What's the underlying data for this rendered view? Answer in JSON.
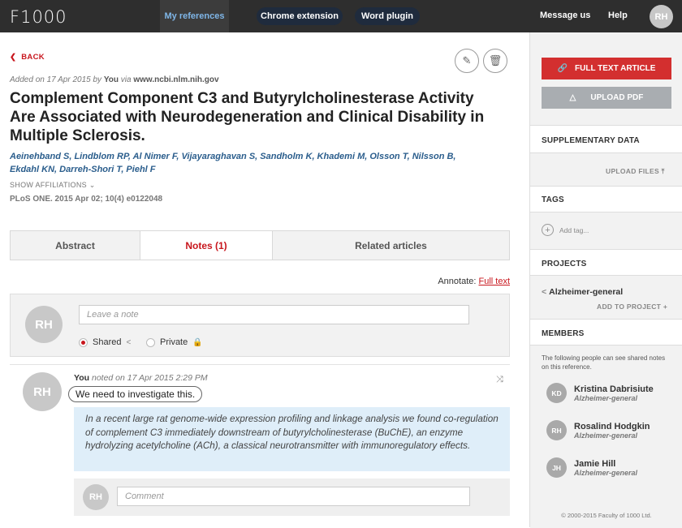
{
  "header": {
    "logo": "F1000",
    "nav_active": "My references",
    "chrome_extension": "Chrome extension",
    "word_plugin": "Word plugin",
    "message_us": "Message us",
    "help": "Help",
    "user_initials": "RH"
  },
  "article": {
    "back_label": "BACK",
    "added_prefix": "Added on 17 Apr 2015 by",
    "added_user": "You",
    "added_via": "via",
    "added_source": "www.ncbi.nlm.nih.gov",
    "title": "Complement Component C3 and Butyrylcholinesterase Activity Are Associated with Neurodegeneration and Clinical Disability in Multiple Sclerosis.",
    "authors": "Aeinehband S, Lindblom RP, Al Nimer F, Vijayaraghavan S, Sandholm K, Khademi M, Olsson T, Nilsson B, Ekdahl KN, Darreh-Shori T, Piehl F",
    "show_affiliations": "SHOW AFFILIATIONS",
    "journal": "PLoS ONE. 2015 Apr 02; 10(4) e0122048"
  },
  "tabs": [
    "Abstract",
    "Notes (1)",
    "Related articles"
  ],
  "annotate": {
    "label": "Annotate:",
    "link": "Full text"
  },
  "new_note": {
    "initials": "RH",
    "placeholder": "Leave a note",
    "shared": "Shared",
    "private": "Private"
  },
  "note": {
    "initials": "RH",
    "author": "You",
    "meta": "noted on 17 Apr 2015 2:29 PM",
    "text": "We need to investigate this.",
    "quote": "In a recent large rat genome-wide expression profiling and linkage analysis we found co-regulation of complement C3 immediately downstream of butyrylcholinesterase (BuChE), an enzyme hydrolyzing acetylcholine (ACh), a classical neurotransmitter with immunoregulatory effects.",
    "comment_initials": "RH",
    "comment_placeholder": "Comment"
  },
  "sidebar": {
    "full_text_button": "FULL TEXT ARTICLE",
    "upload_pdf_button": "UPLOAD PDF",
    "supplementary_title": "SUPPLEMENTARY DATA",
    "upload_files": "UPLOAD FILES",
    "tags_title": "TAGS",
    "add_tag": "Add tag...",
    "projects_title": "PROJECTS",
    "project_name": "Alzheimer-general",
    "add_to_project": "ADD TO PROJECT",
    "members_title": "MEMBERS",
    "members_desc": "The following people can see shared notes on this reference.",
    "members": [
      {
        "initials": "KD",
        "name": "Kristina Dabrisiute",
        "group": "Alzheimer-general"
      },
      {
        "initials": "RH",
        "name": "Rosalind Hodgkin",
        "group": "Alzheimer-general"
      },
      {
        "initials": "JH",
        "name": "Jamie Hill",
        "group": "Alzheimer-general"
      }
    ],
    "copyright": "© 2000-2015 Faculty of 1000 Ltd."
  },
  "colors": {
    "accent_red": "#c8161d",
    "topbar": "#2e2e2e",
    "quote_bg": "#dfeef9"
  }
}
